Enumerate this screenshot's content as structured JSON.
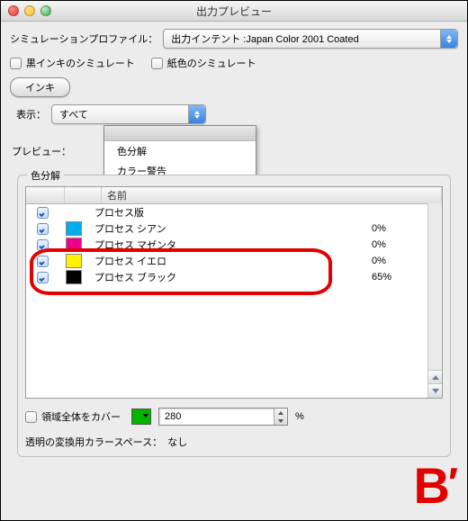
{
  "title": "出力プレビュー",
  "profile": {
    "label": "シミュレーションプロファイル：",
    "value": "出力インテント :Japan Color 2001 Coated"
  },
  "sim_black": "黒インキのシミュレート",
  "sim_paper": "紙色のシミュレート",
  "ink_btn": "インキ",
  "show_label": "表示：",
  "show_value": "すべて",
  "preview_label": "プレビュー：",
  "menu": {
    "item1": "色分解",
    "item2": "カラー警告"
  },
  "group_label": "色分解",
  "col_name": "名前",
  "rows": [
    {
      "name": "プロセス版",
      "color": null,
      "pct": ""
    },
    {
      "name": "プロセス シアン",
      "color": "#00AEEF",
      "pct": "0%"
    },
    {
      "name": "プロセス マゼンタ",
      "color": "#EC008C",
      "pct": "0%"
    },
    {
      "name": "プロセス イエロ",
      "color": "#FFF200",
      "pct": "0%"
    },
    {
      "name": "プロセス ブラック",
      "color": "#000000",
      "pct": "65%"
    }
  ],
  "cover_label": "領域全体をカバー",
  "cover_value": "280",
  "cover_unit": "%",
  "trans_label": "透明の変換用カラースペース：",
  "trans_value": "なし",
  "badge": {
    "b": "B",
    "p": "′"
  }
}
